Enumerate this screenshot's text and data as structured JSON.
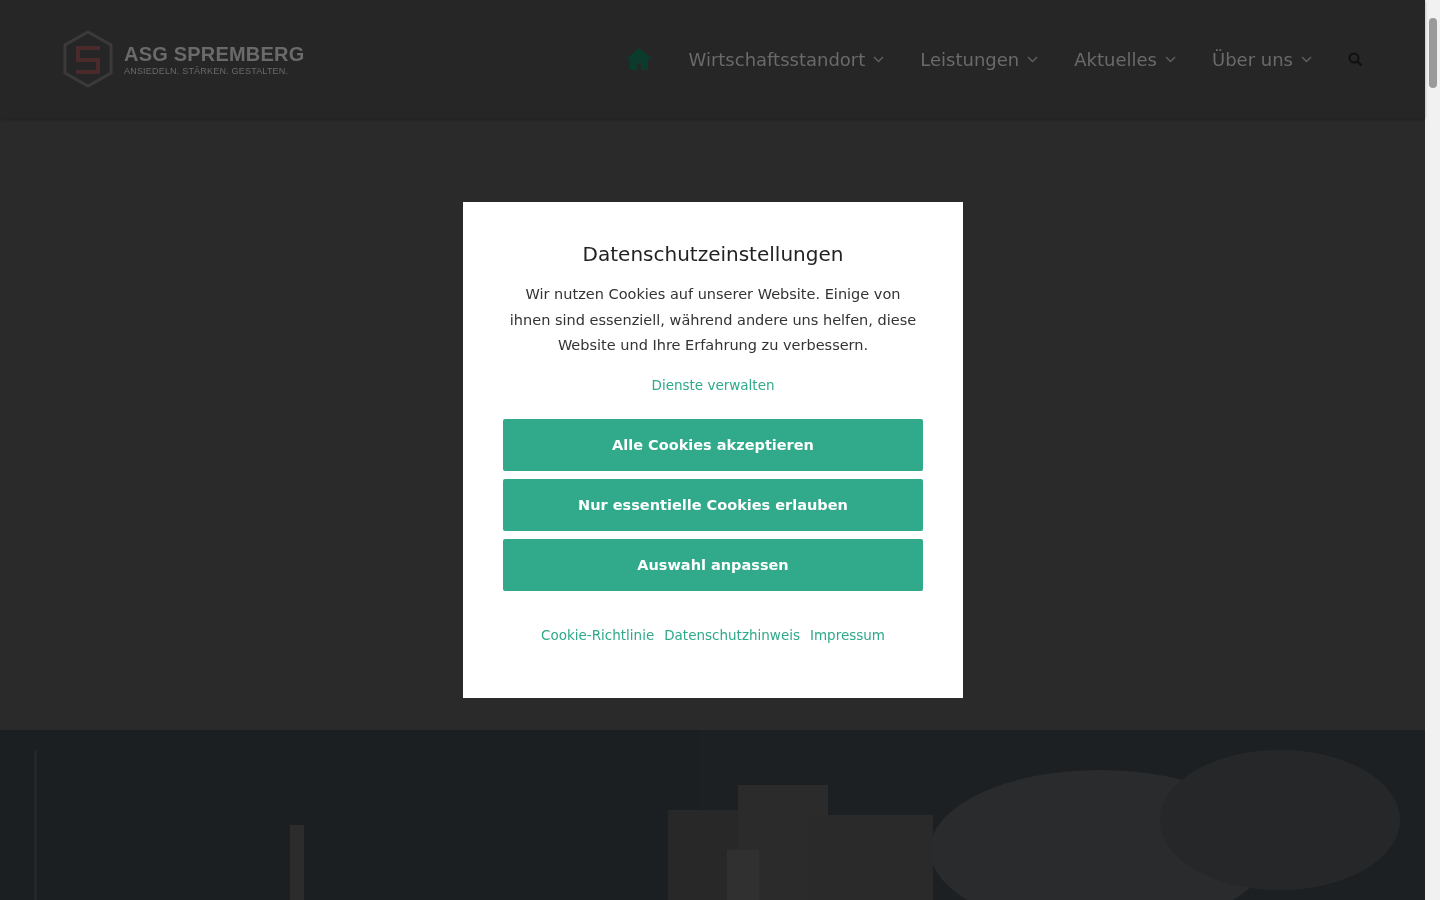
{
  "header": {
    "logo": {
      "name": "ASG SPREMBERG",
      "tagline": "ANSIEDELN. STÄRKEN. GESTALTEN."
    },
    "nav": [
      {
        "label": "Wirtschaftsstandort",
        "has_menu": true
      },
      {
        "label": "Leistungen",
        "has_menu": true
      },
      {
        "label": "Aktuelles",
        "has_menu": true
      },
      {
        "label": "Über uns",
        "has_menu": true
      }
    ]
  },
  "cookie_dialog": {
    "title": "Datenschutzeinstellungen",
    "text": "Wir nutzen Cookies auf unserer Website. Einige von ihnen sind essenziell, während andere uns helfen, diese Website und Ihre Erfahrung zu verbessern.",
    "manage_link": "Dienste verwalten",
    "buttons": [
      "Alle Cookies akzeptieren",
      "Nur essentielle Cookies erlauben",
      "Auswahl anpassen"
    ],
    "footer_links": [
      "Cookie-Richtlinie",
      "Datenschutzhinweis",
      "Impressum"
    ]
  }
}
